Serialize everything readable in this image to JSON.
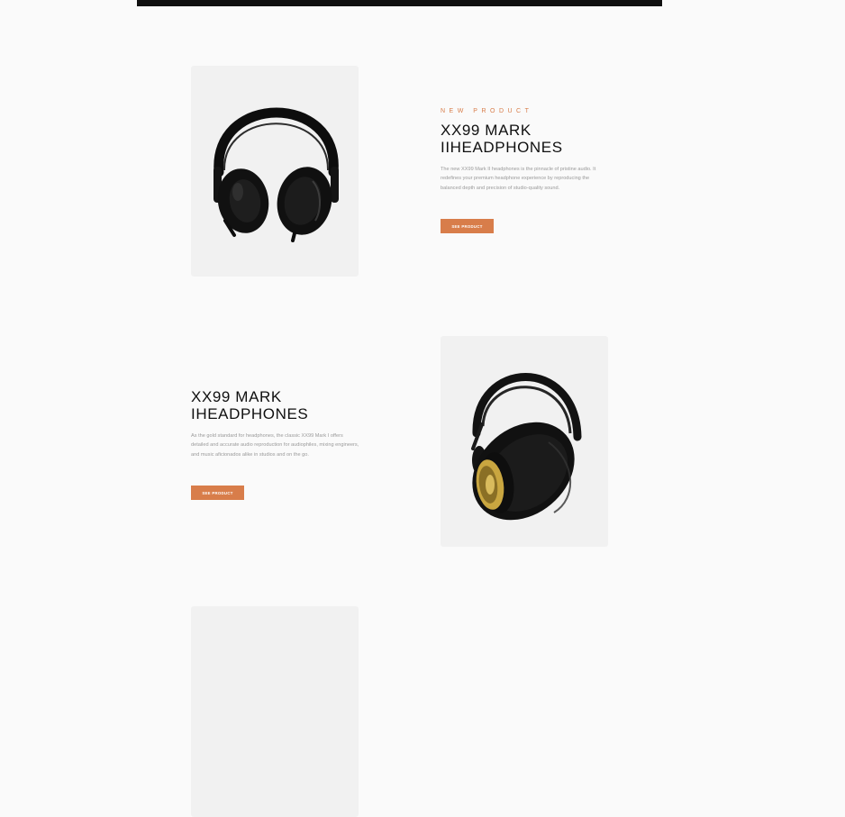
{
  "products": [
    {
      "overline": "NEW PRODUCT",
      "title_line1": "XX99 MARK",
      "title_line2": "IIHEADPHONES",
      "description": "The new XX99 Mark II headphones is the pinnacle of pristine audio. It redefines your premium headphone experience by reproducing the balanced depth and precision of studio-quality sound.",
      "button_label": "SEE PRODUCT",
      "image_icon": "headphones-black-closed-icon"
    },
    {
      "title_line1": "XX99 MARK",
      "title_line2": "IHEADPHONES",
      "description": "As the gold standard for headphones, the classic XX99 Mark I offers detailed and accurate audio reproduction for audiophiles, mixing engineers, and music aficionados alike in studios and on the go.",
      "button_label": "SEE PRODUCT",
      "image_icon": "headphones-gold-studio-icon"
    }
  ],
  "colors": {
    "accent": "#d87d4a",
    "page_background": "#fafafa",
    "card_background": "#f1f1f1",
    "header_background": "#101010",
    "title_text": "#101010",
    "body_text": "#9a9a9a"
  }
}
